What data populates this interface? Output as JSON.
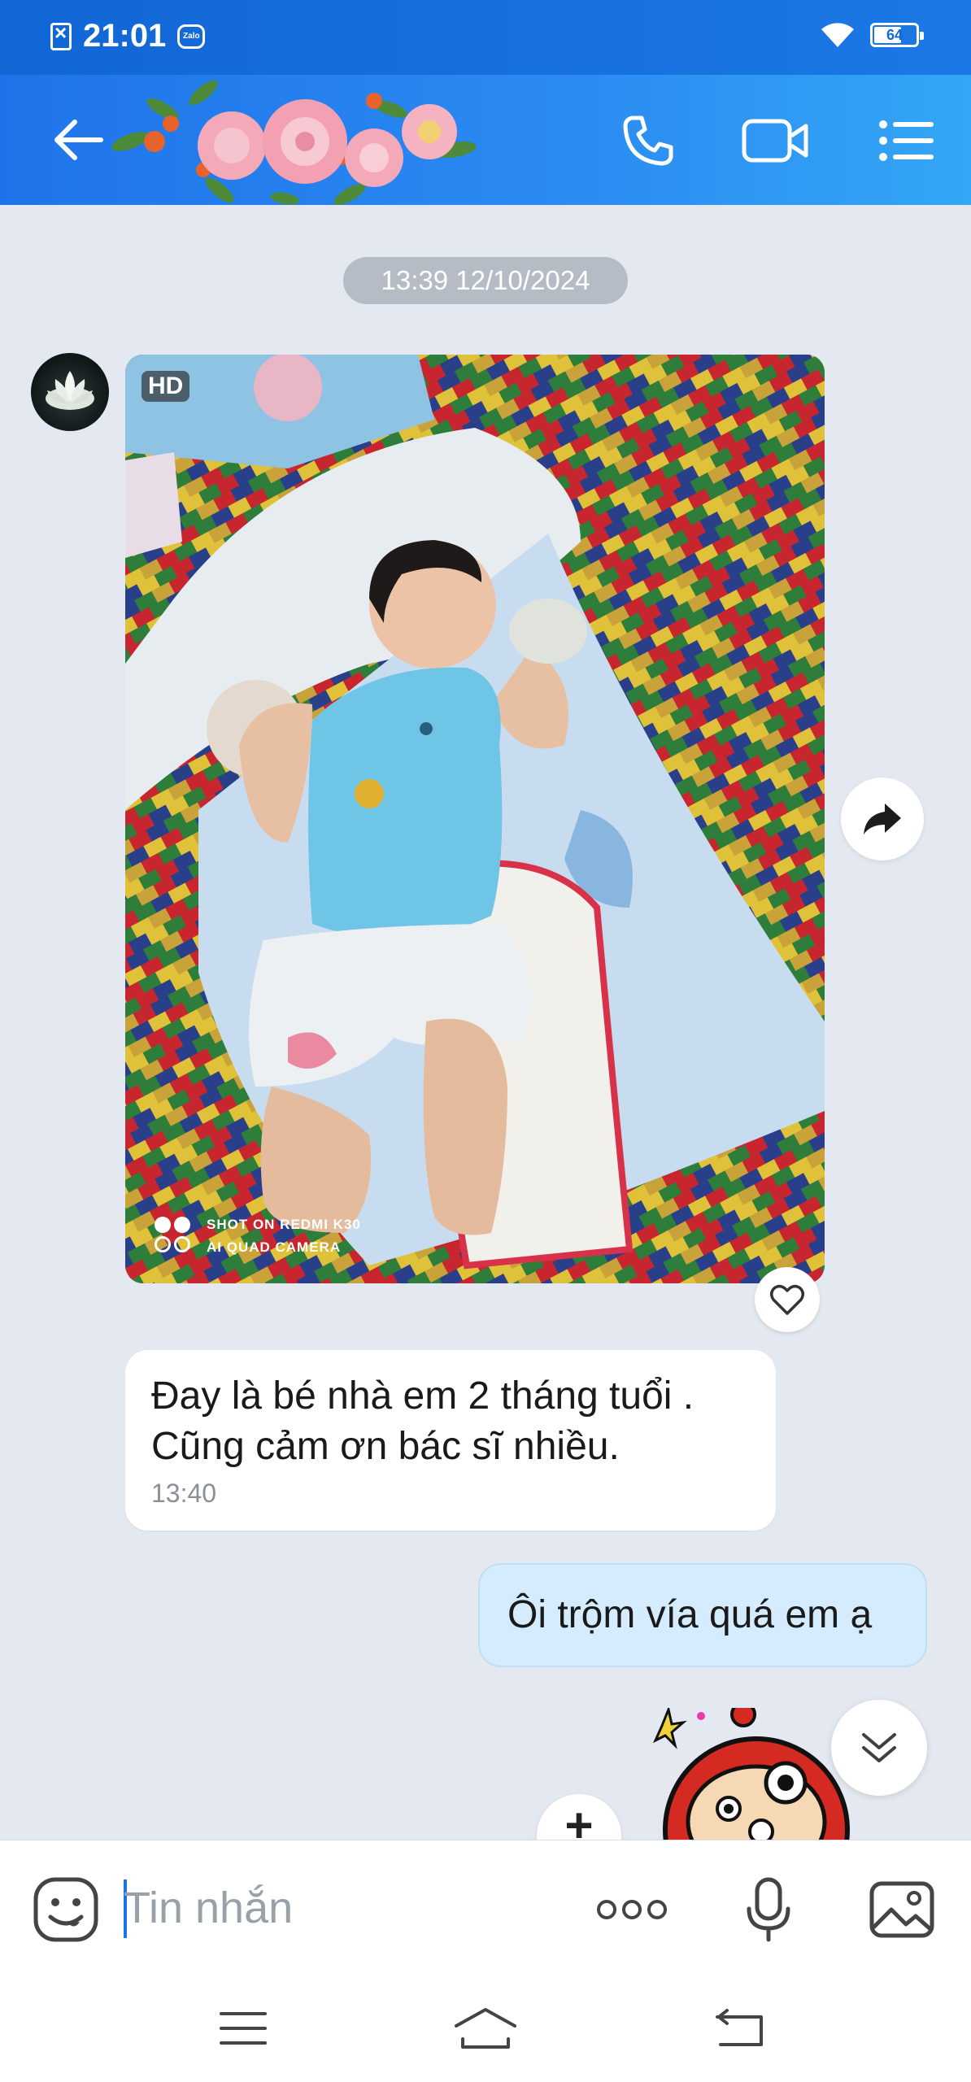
{
  "status_bar": {
    "time": "21:01",
    "battery": "64",
    "zalo_label": "Zalo"
  },
  "header": {
    "icons": [
      "back-arrow-icon",
      "phone-icon",
      "video-call-icon",
      "menu-list-icon"
    ]
  },
  "chat": {
    "date_divider": "13:39 12/10/2024",
    "photo": {
      "hd_label": "HD",
      "watermark_line1": "SHOT ON REDMI K30",
      "watermark_line2": "AI QUAD CAMERA"
    },
    "incoming_message": {
      "text": "Đay là bé nhà em 2 tháng tuổi .\nCũng  cảm ơn bác sĩ nhiều.",
      "time": "13:40"
    },
    "outgoing_message": {
      "text": "Ôi trộm vía quá em ạ"
    }
  },
  "composer": {
    "placeholder": "Tin nhắn"
  },
  "colors": {
    "header_blue": "#1f73ea",
    "outgoing_bubble": "#d4ecfd",
    "background": "#e4e8f0"
  }
}
